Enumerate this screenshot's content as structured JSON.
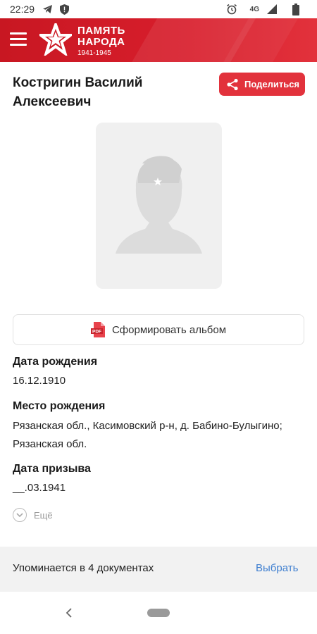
{
  "status_bar": {
    "time": "22:29",
    "left_icons": [
      "telegram-icon",
      "shield-icon"
    ],
    "network": "4G",
    "right_icons": [
      "alarm-icon",
      "signal-icon",
      "battery-icon"
    ]
  },
  "app_bar": {
    "logo_line1": "ПАМЯТЬ",
    "logo_line2": "НАРОДА",
    "logo_years": "1941-1945",
    "brand_color": "#d81e2c"
  },
  "person": {
    "name": "Костригин Василий Алексеевич"
  },
  "share_button": {
    "label": "Поделиться"
  },
  "album_button": {
    "label": "Сформировать альбом"
  },
  "fields": [
    {
      "label": "Дата рождения",
      "value": "16.12.1910"
    },
    {
      "label": "Место рождения",
      "value": "Рязанская обл., Касимовский р-н, д. Бабино-Булыгино; Рязанская обл."
    },
    {
      "label": "Дата призыва",
      "value": "__.03.1941"
    }
  ],
  "more": {
    "label": "Ещё"
  },
  "documents": {
    "text": "Упоминается в 4 документах",
    "action": "Выбрать",
    "action_color": "#3f7fd0"
  }
}
